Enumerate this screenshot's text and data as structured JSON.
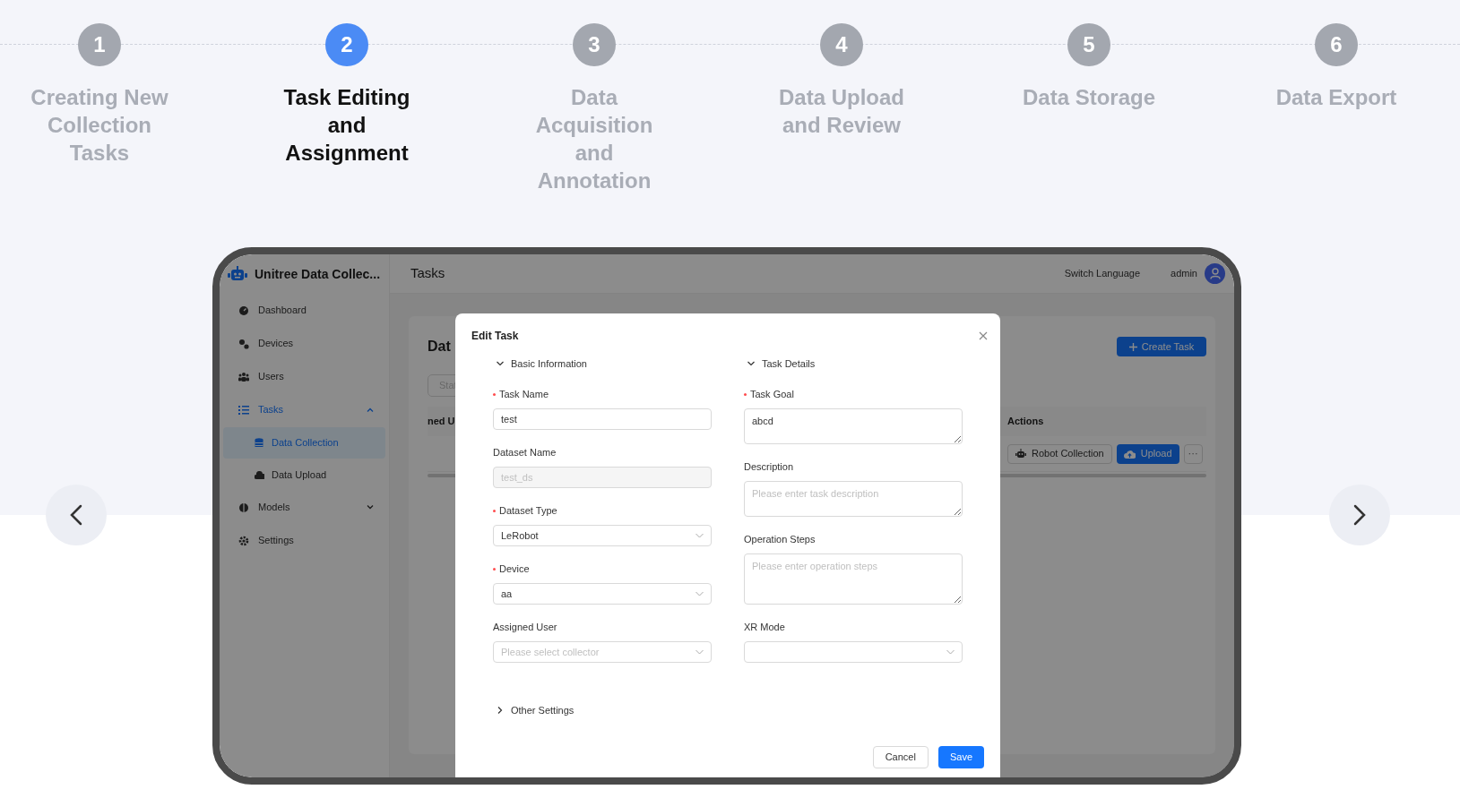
{
  "steps": [
    {
      "number": "1",
      "label": "Creating New Collection Tasks",
      "selected": false
    },
    {
      "number": "2",
      "label": "Task Editing and Assignment",
      "selected": true
    },
    {
      "number": "3",
      "label": "Data Acquisition and Annotation",
      "selected": false
    },
    {
      "number": "4",
      "label": "Data Upload and Review",
      "selected": false
    },
    {
      "number": "5",
      "label": "Data Storage",
      "selected": false
    },
    {
      "number": "6",
      "label": "Data Export",
      "selected": false
    }
  ],
  "app": {
    "brand": "Unitree Data Collec...",
    "page_title": "Tasks",
    "switch_language": "Switch Language",
    "user": "admin",
    "sidebar": [
      {
        "label": "Dashboard",
        "selected": false
      },
      {
        "label": "Devices",
        "selected": false
      },
      {
        "label": "Users",
        "selected": false
      },
      {
        "label": "Tasks",
        "selected": false,
        "expanded": true,
        "children": [
          {
            "label": "Data Collection",
            "selected": true
          },
          {
            "label": "Data Upload",
            "selected": false
          }
        ]
      },
      {
        "label": "Models",
        "selected": false,
        "expanded": false
      },
      {
        "label": "Settings",
        "selected": false
      }
    ],
    "content": {
      "heading": "Dat",
      "filter_placeholder": "Stat",
      "create_button": "Create Task",
      "columns": [
        "ned U",
        "Actions"
      ],
      "row_actions": [
        {
          "label": "Robot Collection",
          "kind": "default"
        },
        {
          "label": "Upload",
          "kind": "primary"
        },
        {
          "label": "···",
          "kind": "more"
        }
      ]
    }
  },
  "modal": {
    "title": "Edit Task",
    "sections": [
      {
        "title": "Basic Information",
        "expanded": true,
        "fields": [
          {
            "label": "Task Name",
            "required": true,
            "kind": "text",
            "value": "test"
          },
          {
            "label": "Dataset Name",
            "required": false,
            "kind": "text",
            "value": "test_ds",
            "disabled": true
          },
          {
            "label": "Dataset Type",
            "required": true,
            "kind": "select",
            "value": "LeRobot"
          },
          {
            "label": "Device",
            "required": true,
            "kind": "select",
            "value": "aa"
          },
          {
            "label": "Assigned User",
            "required": false,
            "kind": "select",
            "placeholder": "Please select collector"
          }
        ]
      },
      {
        "title": "Task Details",
        "expanded": true,
        "fields": [
          {
            "label": "Task Goal",
            "required": true,
            "kind": "textarea",
            "value": "abcd"
          },
          {
            "label": "Description",
            "required": false,
            "kind": "textarea",
            "placeholder": "Please enter task description"
          },
          {
            "label": "Operation Steps",
            "required": false,
            "kind": "textarea",
            "placeholder": "Please enter operation steps"
          },
          {
            "label": "XR Mode",
            "required": false,
            "kind": "select"
          }
        ]
      }
    ],
    "other_settings": {
      "title": "Other Settings",
      "expanded": false
    },
    "buttons": [
      {
        "label": "Cancel",
        "kind": "default"
      },
      {
        "label": "Save",
        "kind": "primary"
      }
    ]
  }
}
